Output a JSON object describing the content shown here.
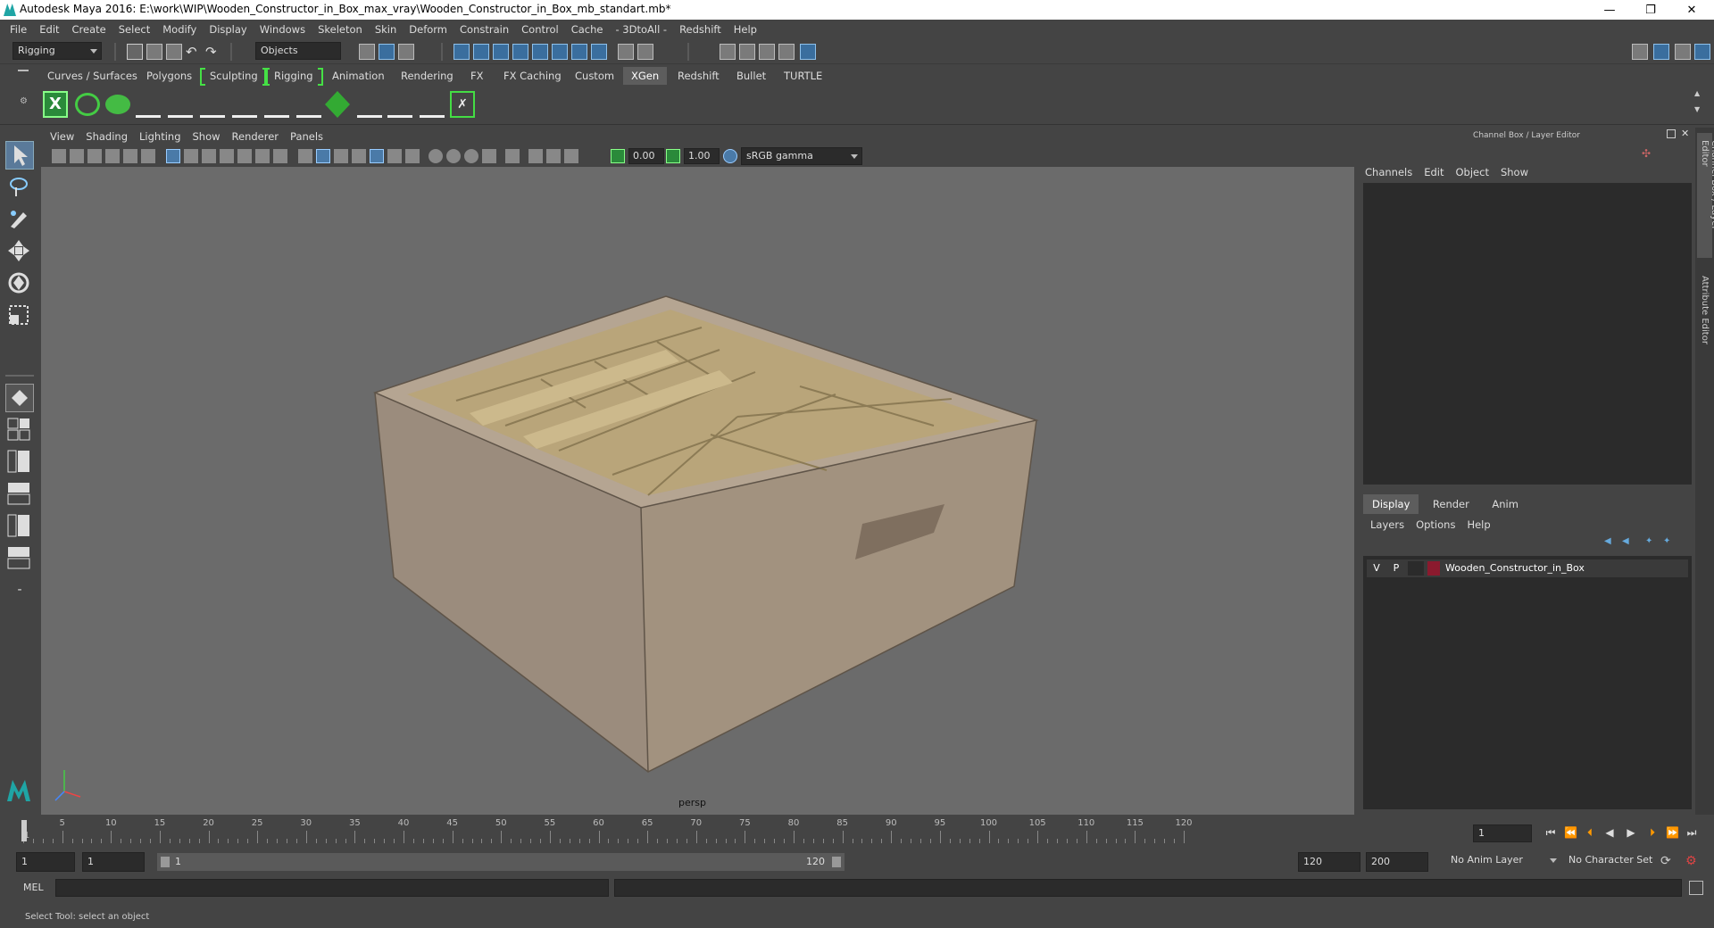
{
  "window": {
    "title": "Autodesk Maya 2016: E:\\work\\WIP\\Wooden_Constructor_in_Box_max_vray\\Wooden_Constructor_in_Box_mb_standart.mb*",
    "minimize": "—",
    "restore": "❐",
    "close": "✕"
  },
  "menus": [
    "File",
    "Edit",
    "Create",
    "Select",
    "Modify",
    "Display",
    "Windows",
    "Skeleton",
    "Skin",
    "Deform",
    "Constrain",
    "Control",
    "Cache",
    "- 3DtoAll -",
    "Redshift",
    "Help"
  ],
  "statusline": {
    "menuset": "Rigging",
    "selection_mode": "Objects"
  },
  "shelf_tabs": [
    {
      "label": "Curves / Surfaces"
    },
    {
      "label": "Polygons"
    },
    {
      "label": "Sculpting"
    },
    {
      "label": "Rigging"
    },
    {
      "label": "Animation"
    },
    {
      "label": "Rendering"
    },
    {
      "label": "FX"
    },
    {
      "label": "FX Caching"
    },
    {
      "label": "Custom"
    },
    {
      "label": "XGen"
    },
    {
      "label": "Redshift"
    },
    {
      "label": "Bullet"
    },
    {
      "label": "TURTLE"
    }
  ],
  "active_shelf": "XGen",
  "viewport": {
    "menus": [
      "View",
      "Shading",
      "Lighting",
      "Show",
      "Renderer",
      "Panels"
    ],
    "exposure": "0.00",
    "gamma": "1.00",
    "colorspace": "sRGB gamma",
    "camera_label": "persp"
  },
  "channel_box": {
    "title": "Channel Box / Layer Editor",
    "menus": [
      "Channels",
      "Edit",
      "Object",
      "Show"
    ]
  },
  "layer_editor": {
    "tabs": [
      "Display",
      "Render",
      "Anim"
    ],
    "active_tab": "Display",
    "menus": [
      "Layers",
      "Options",
      "Help"
    ],
    "layers": [
      {
        "visible": "V",
        "playback": "P",
        "color": "#8b1a2e",
        "name": "Wooden_Constructor_in_Box"
      }
    ]
  },
  "side_tabs": [
    "Channel Box / Layer Editor",
    "Attribute Editor"
  ],
  "timeline": {
    "ticks": [
      "1",
      "5",
      "10",
      "15",
      "20",
      "25",
      "30",
      "35",
      "40",
      "45",
      "50",
      "55",
      "60",
      "65",
      "70",
      "75",
      "80",
      "85",
      "90",
      "95",
      "100",
      "105",
      "110",
      "115",
      "120"
    ],
    "current_frame": "1"
  },
  "range": {
    "start": "1",
    "playback_start": "1",
    "slider_start": "1",
    "slider_end": "120",
    "playback_end": "120",
    "end": "200",
    "anim_layer": "No Anim Layer",
    "character_set": "No Character Set"
  },
  "cmdline": {
    "label": "MEL"
  },
  "helpline": {
    "text": "Select Tool: select an object"
  }
}
